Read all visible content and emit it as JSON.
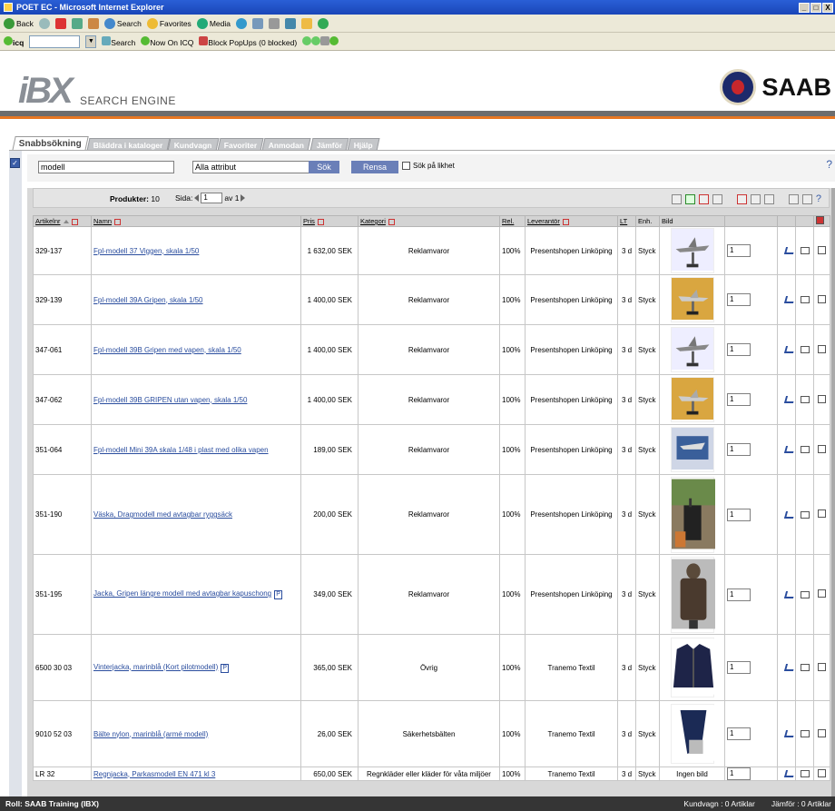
{
  "window": {
    "title": "POET EC - Microsoft Internet Explorer",
    "buttons": [
      "_",
      "□",
      "X"
    ]
  },
  "ie_toolbar": {
    "back": "Back",
    "search": "Search",
    "favorites": "Favorites",
    "media": "Media"
  },
  "ie_toolbar2": {
    "icq": "icq",
    "search": "Search",
    "now_on_icq": "Now On ICQ",
    "popups": "Block PopUps (0 blocked)"
  },
  "header": {
    "logo": "iBX",
    "engine_label": "SEARCH ENGINE",
    "brand": "SAAB"
  },
  "tabs": [
    {
      "label": "Snabbsökning",
      "active": true
    },
    {
      "label": "Bläddra i kataloger"
    },
    {
      "label": "Kundvagn"
    },
    {
      "label": "Favoriter"
    },
    {
      "label": "Anmodan"
    },
    {
      "label": "Jämför"
    },
    {
      "label": "Hjälp"
    }
  ],
  "search": {
    "query": "modell",
    "attribute": "Alla attribut",
    "search_button": "Sök",
    "reset_button": "Rensa",
    "similar_label": "Sök på likhet",
    "help": "?"
  },
  "results_bar": {
    "products_label": "Produkter:",
    "products_count": "10",
    "page_label": "Sida:",
    "page_value": "1",
    "page_of": "av 1",
    "help": "?"
  },
  "columns": [
    "Artikelnr",
    "Namn",
    "Pris",
    "Kategori",
    "Rel.",
    "Leverantör",
    "LT",
    "Enh.",
    "Bild"
  ],
  "rows": [
    {
      "art": "329-137",
      "name": "Fpl-modell 37 Viggen, skala 1/50",
      "price": "1 632,00 SEK",
      "cat": "Reklamvaror",
      "rel": "100%",
      "supplier": "Presentshopen Linköping",
      "lt": "3 d",
      "unit": "Styck",
      "qty": "1",
      "img": "plane-grey"
    },
    {
      "art": "329-139",
      "name": "Fpl-modell 39A Gripen, skala 1/50",
      "price": "1 400,00 SEK",
      "cat": "Reklamvaror",
      "rel": "100%",
      "supplier": "Presentshopen Linköping",
      "lt": "3 d",
      "unit": "Styck",
      "qty": "1",
      "img": "plane-yellow"
    },
    {
      "art": "347-061",
      "name": "Fpl-modell 39B Gripen med vapen, skala 1/50",
      "price": "1 400,00 SEK",
      "cat": "Reklamvaror",
      "rel": "100%",
      "supplier": "Presentshopen Linköping",
      "lt": "3 d",
      "unit": "Styck",
      "qty": "1",
      "img": "plane-grey"
    },
    {
      "art": "347-062",
      "name": "Fpl-modell 39B GRIPEN utan vapen, skala 1/50",
      "price": "1 400,00 SEK",
      "cat": "Reklamvaror",
      "rel": "100%",
      "supplier": "Presentshopen Linköping",
      "lt": "3 d",
      "unit": "Styck",
      "qty": "1",
      "img": "plane-yellow"
    },
    {
      "art": "351-064",
      "name": "Fpl-modell Mini 39A skala 1/48 i plast med olika vapen",
      "price": "189,00 SEK",
      "cat": "Reklamvaror",
      "rel": "100%",
      "supplier": "Presentshopen Linköping",
      "lt": "3 d",
      "unit": "Styck",
      "qty": "1",
      "img": "plane-box"
    },
    {
      "art": "351-190",
      "name": "Väska, Dragmodell med avtagbar ryggsäck",
      "price": "200,00 SEK",
      "cat": "Reklamvaror",
      "rel": "100%",
      "supplier": "Presentshopen Linköping",
      "lt": "3 d",
      "unit": "Styck",
      "qty": "1",
      "img": "bag"
    },
    {
      "art": "351-195",
      "name": "Jacka, Gripen längre modell med avtagbar kapuschong",
      "price": "349,00 SEK",
      "cat": "Reklamvaror",
      "rel": "100%",
      "supplier": "Presentshopen Linköping",
      "lt": "3 d",
      "unit": "Styck",
      "qty": "1",
      "img": "jacket-brown",
      "p": "P"
    },
    {
      "art": "6500 30 03",
      "name": "Vinterjacka, marinblå (Kort pilotmodell)",
      "price": "365,00 SEK",
      "cat": "Övrig",
      "rel": "100%",
      "supplier": "Tranemo Textil",
      "lt": "3 d",
      "unit": "Styck",
      "qty": "1",
      "img": "jacket-navy",
      "p": "P"
    },
    {
      "art": "9010 52 03",
      "name": "Bälte nylon, marinblå (armé modell)",
      "price": "26,00 SEK",
      "cat": "Säkerhetsbälten",
      "rel": "100%",
      "supplier": "Tranemo Textil",
      "lt": "3 d",
      "unit": "Styck",
      "qty": "1",
      "img": "belt"
    },
    {
      "art": "LR 32",
      "name": "Regnjacka, Parkasmodell EN 471 kl 3",
      "price": "650,00 SEK",
      "cat": "Regnkläder eller kläder för våta miljöer",
      "rel": "100%",
      "supplier": "Tranemo Textil",
      "lt": "3 d",
      "unit": "Styck",
      "qty": "1",
      "img_text": "Ingen bild"
    }
  ],
  "status": {
    "role": "Roll: SAAB Training (IBX)",
    "cart": "Kundvagn : 0 Artiklar",
    "compare": "Jämför : 0 Artiklar"
  },
  "colors": {
    "accent": "#e87722",
    "button": "#6a7fb8",
    "link": "#2a4d9e"
  }
}
